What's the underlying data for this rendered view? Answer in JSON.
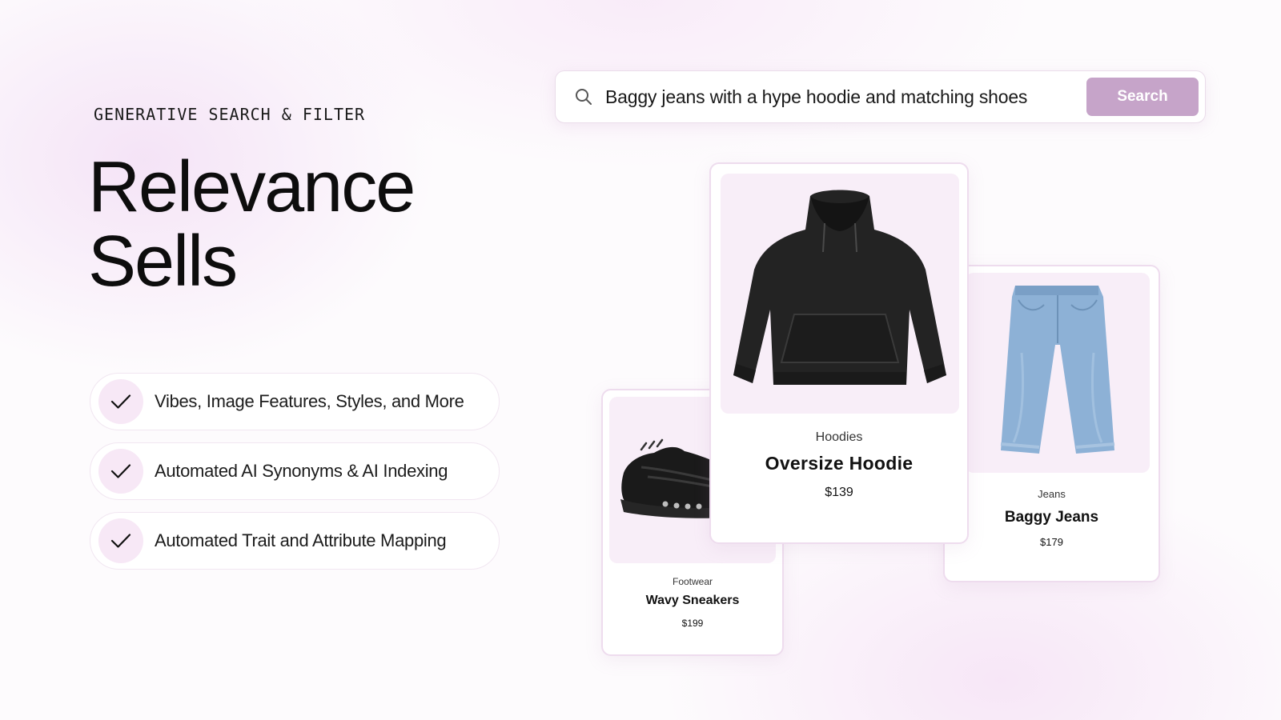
{
  "hero": {
    "eyebrow": "GENERATIVE SEARCH & FILTER",
    "headline_line1": "Relevance",
    "headline_line2": "Sells"
  },
  "features": [
    {
      "label": "Vibes, Image Features, Styles, and More",
      "icon": "check-icon"
    },
    {
      "label": "Automated AI Synonyms & AI Indexing",
      "icon": "check-icon"
    },
    {
      "label": "Automated Trait and Attribute Mapping",
      "icon": "check-icon"
    }
  ],
  "search": {
    "icon": "search-icon",
    "value": "Baggy jeans with a hype hoodie and matching shoes",
    "button_label": "Search"
  },
  "products": [
    {
      "category": "Footwear",
      "name": "Wavy Sneakers",
      "price": "$199",
      "image": "sneaker-image"
    },
    {
      "category": "Hoodies",
      "name": "Oversize Hoodie",
      "price": "$139",
      "image": "hoodie-image"
    },
    {
      "category": "Jeans",
      "name": "Baggy Jeans",
      "price": "$179",
      "image": "jeans-image"
    }
  ],
  "colors": {
    "accent": "#c6a4c9",
    "card_border": "#eedcee",
    "image_bg": "#f8eef8",
    "check_bg": "#f7e8f6"
  }
}
